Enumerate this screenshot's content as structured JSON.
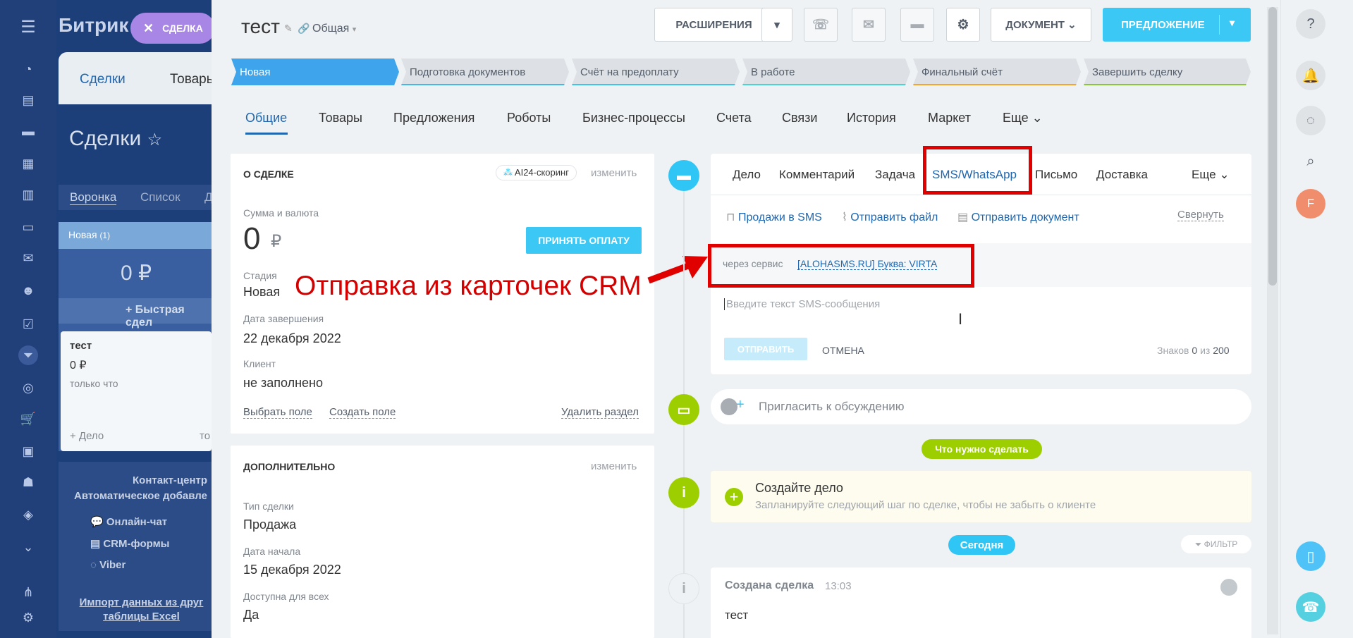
{
  "background": {
    "app_title": "Битрик",
    "deal_chip": "СДЕЛКА",
    "tabs": [
      "Сделки",
      "Товары"
    ],
    "page_title": "Сделки",
    "views": [
      "Воронка",
      "Список",
      "Д"
    ],
    "column": {
      "name": "Новая",
      "count": "(1)",
      "sum": "0 ₽",
      "quick_add": "+ Быстрая сдел"
    },
    "card": {
      "title": "тест",
      "sum": "0 ₽",
      "time": "только что",
      "add": "+ Дело",
      "extra": "то"
    },
    "contact_center": {
      "title": "Контакт-центр",
      "subtitle": "Автоматическое добавле",
      "items": [
        "Онлайн-чат",
        "CRM-формы",
        "Viber"
      ]
    },
    "import_text": "Импорт данных из друг таблицы Excel"
  },
  "header": {
    "deal_title": "тест",
    "category": "Общая",
    "btn_extensions": "РАСШИРЕНИЯ",
    "btn_document": "ДОКУМЕНТ",
    "btn_offer": "ПРЕДЛОЖЕНИЕ"
  },
  "stages": [
    {
      "label": "Новая",
      "color": "#3ea4ec",
      "text_color": "#ffffff",
      "underline": "#3ea4ec"
    },
    {
      "label": "Подготовка документов",
      "color": "#dde1e5",
      "text_color": "#535c69",
      "underline": "#47b5ea"
    },
    {
      "label": "Счёт на предоплату",
      "color": "#dde1e5",
      "text_color": "#535c69",
      "underline": "#3fc3e8"
    },
    {
      "label": "В работе",
      "color": "#dde1e5",
      "text_color": "#535c69",
      "underline": "#4ad3d0"
    },
    {
      "label": "Финальный счёт",
      "color": "#dde1e5",
      "text_color": "#535c69",
      "underline": "#f5a32a"
    },
    {
      "label": "Завершить сделку",
      "color": "#dde1e5",
      "text_color": "#535c69",
      "underline": "#8ac43c"
    }
  ],
  "main_tabs": [
    "Общие",
    "Товары",
    "Предложения",
    "Роботы",
    "Бизнес-процессы",
    "Счета",
    "Связи",
    "История",
    "Маркет",
    "Еще"
  ],
  "about": {
    "title": "О СДЕЛКЕ",
    "ai_badge": "AI24-скоринг",
    "edit": "изменить",
    "amount_label": "Сумма и валюта",
    "amount": "0",
    "currency": "₽",
    "accept_payment": "ПРИНЯТЬ ОПЛАТУ",
    "stage_label": "Стадия",
    "stage": "Новая",
    "close_date_label": "Дата завершения",
    "close_date": "22 декабря 2022",
    "client_label": "Клиент",
    "client": "не заполнено",
    "choose_field": "Выбрать поле",
    "create_field": "Создать поле",
    "delete_section": "Удалить раздел"
  },
  "additional": {
    "title": "ДОПОЛНИТЕЛЬНО",
    "edit": "изменить",
    "type_label": "Тип сделки",
    "type": "Продажа",
    "start_label": "Дата начала",
    "start": "15 декабря 2022",
    "public_label": "Доступна для всех",
    "public": "Да"
  },
  "annotation": "Отправка из карточек CRM",
  "activity_tabs": [
    "Дело",
    "Комментарий",
    "Задача",
    "SMS/WhatsApp",
    "Письмо",
    "Доставка",
    "Еще"
  ],
  "sms": {
    "sales_in_sms": "Продажи в SMS",
    "send_file": "Отправить файл",
    "send_document": "Отправить документ",
    "collapse": "Свернуть",
    "via_service": "через сервис",
    "service": "[ALOHASMS.RU] Буква: VIRTA",
    "placeholder": "Введите текст SMS-сообщения",
    "send": "ОТПРАВИТЬ",
    "cancel": "ОТМЕНА",
    "chars_label": "Знаков",
    "chars_count": "0",
    "chars_of": "из",
    "chars_max": "200"
  },
  "invite": "Пригласить к обсуждению",
  "todo_badge": "Что нужно сделать",
  "create_task": {
    "title": "Создайте дело",
    "subtitle": "Запланируйте следующий шаг по сделке, чтобы не забыть о клиенте"
  },
  "today_badge": "Сегодня",
  "filter": "ФИЛЬТР",
  "history": {
    "title": "Создана сделка",
    "time": "13:03",
    "text": "тест"
  },
  "user_initial": "F"
}
